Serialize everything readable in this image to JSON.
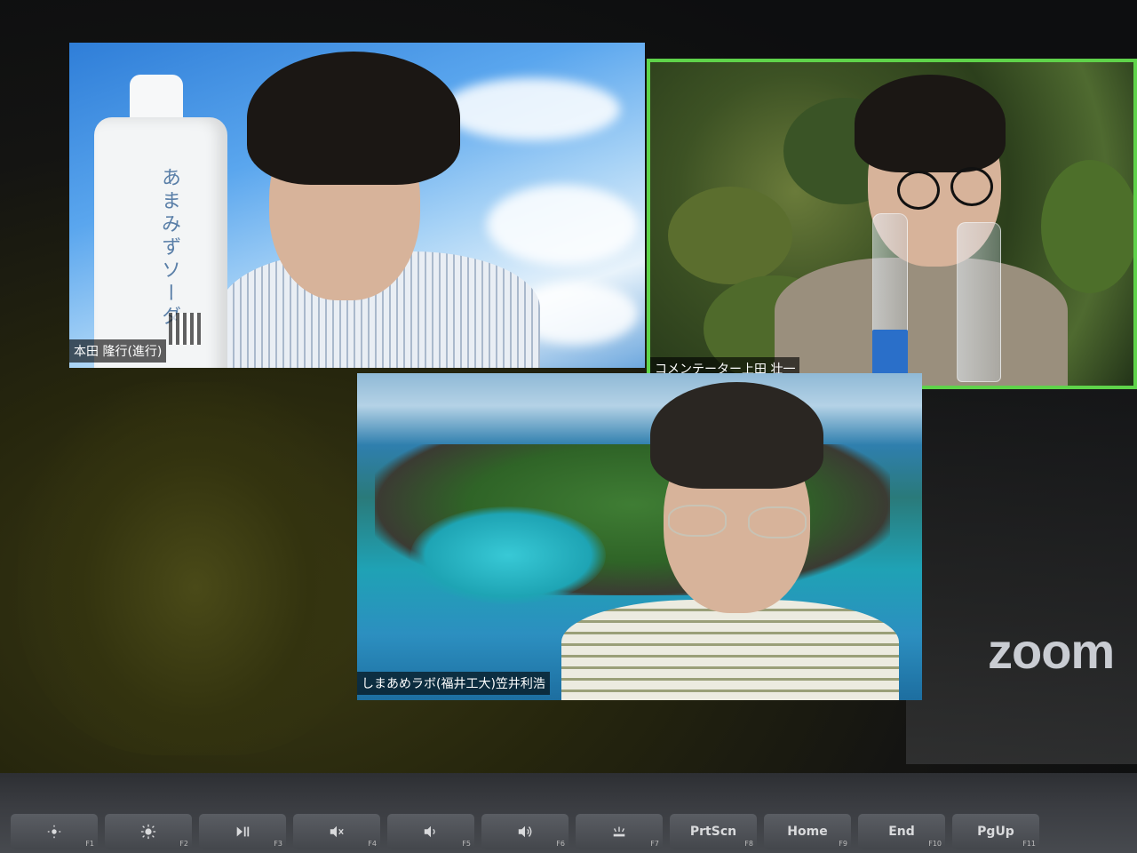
{
  "participants": [
    {
      "name": "本田 隆行(進行)",
      "active_speaker": false
    },
    {
      "name": "コメンテーター上田 壮一",
      "active_speaker": true
    },
    {
      "name": "しまあめラボ(福井工大)笠井利浩",
      "active_speaker": false
    }
  ],
  "bottle_label": "あまみずソーダ",
  "app_logo": "zoom",
  "active_speaker_color": "#5fd34a",
  "keyboard": {
    "keys": [
      {
        "label": "",
        "fn": "F1",
        "icon": "brightness-low-icon"
      },
      {
        "label": "",
        "fn": "F2",
        "icon": "brightness-high-icon"
      },
      {
        "label": "",
        "fn": "F3",
        "icon": "play-pause-icon"
      },
      {
        "label": "",
        "fn": "F4",
        "icon": "mute-icon"
      },
      {
        "label": "",
        "fn": "F5",
        "icon": "volume-down-icon"
      },
      {
        "label": "",
        "fn": "F6",
        "icon": "volume-up-icon"
      },
      {
        "label": "",
        "fn": "F7",
        "icon": "backlight-icon"
      },
      {
        "label": "PrtScn",
        "fn": "F8"
      },
      {
        "label": "Home",
        "fn": "F9"
      },
      {
        "label": "End",
        "fn": "F10"
      },
      {
        "label": "PgUp",
        "fn": "F11"
      }
    ]
  }
}
